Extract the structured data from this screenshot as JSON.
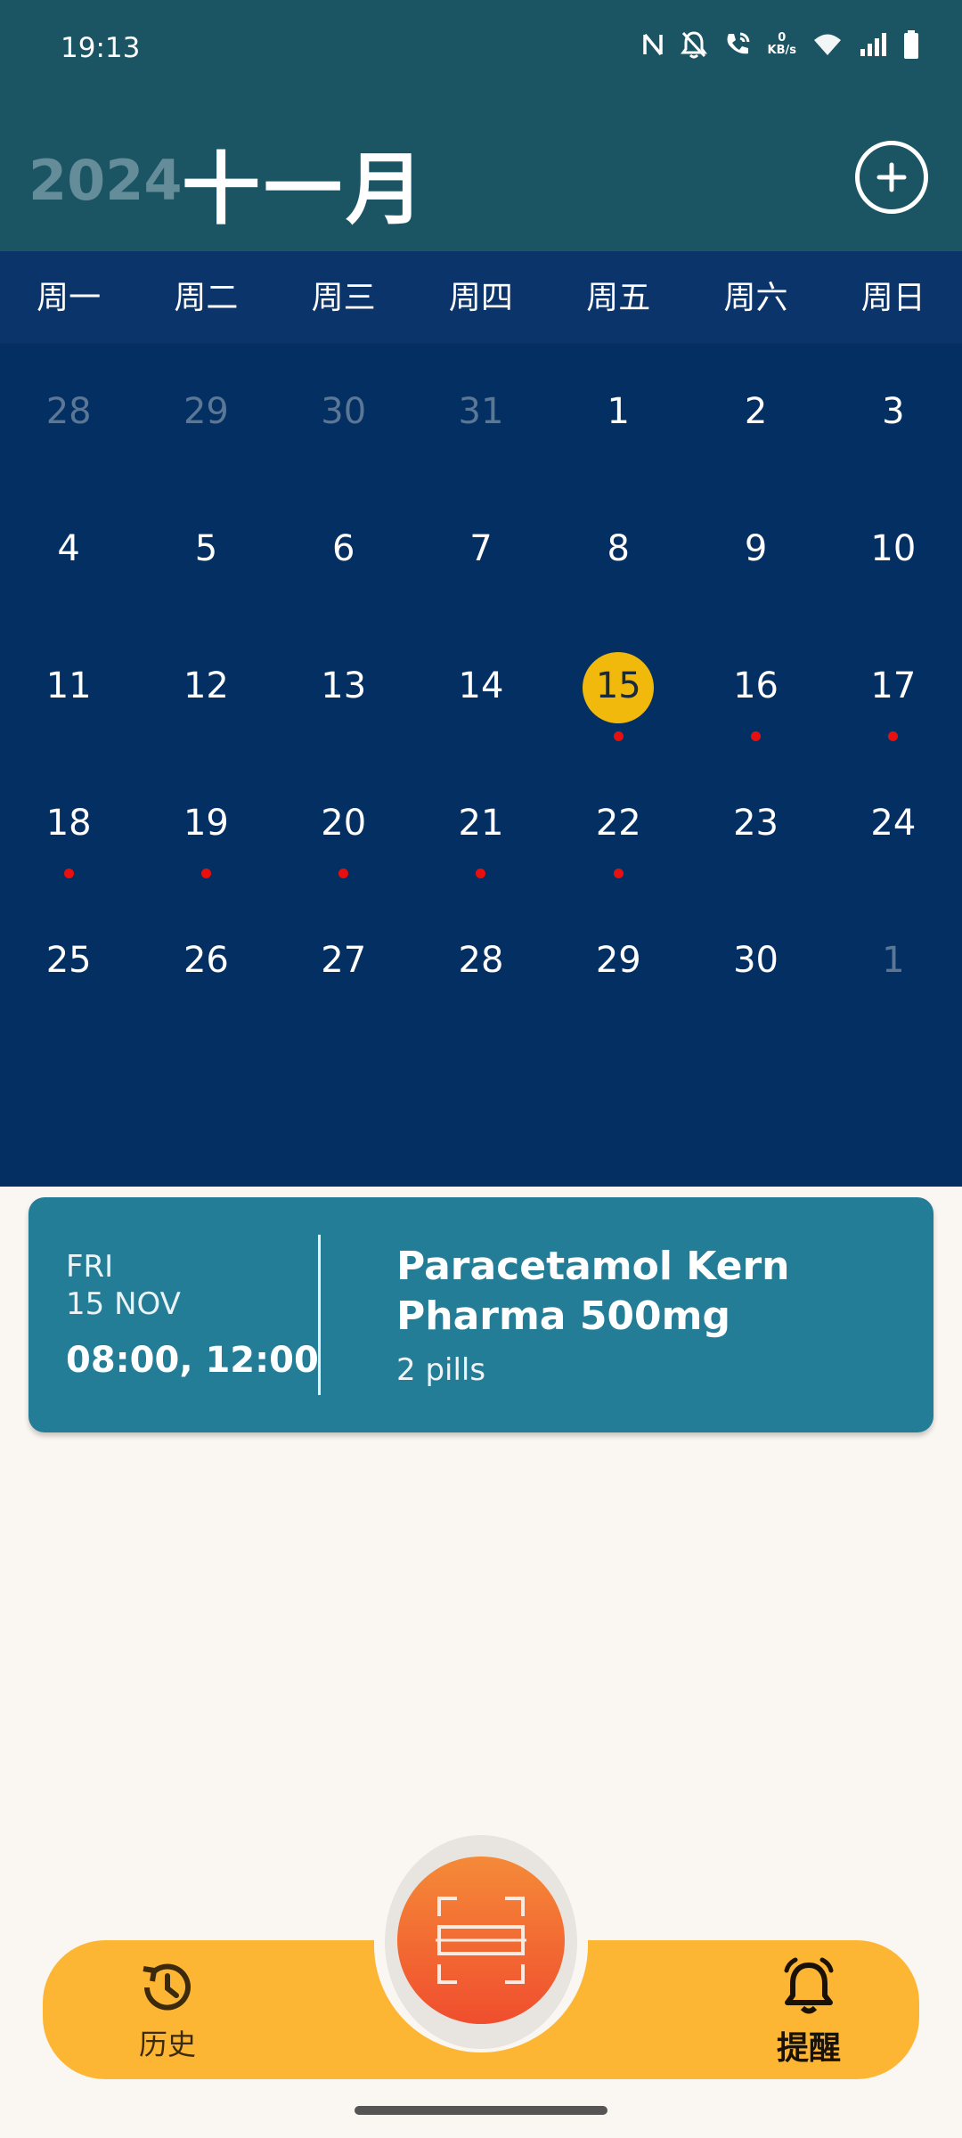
{
  "status": {
    "time": "19:13",
    "net_speed_value": "0",
    "net_speed_unit": "KB/s",
    "icons": [
      "nfc-icon",
      "bell-off-icon",
      "wifi-calling-icon",
      "wifi-icon",
      "signal-icon",
      "battery-icon"
    ]
  },
  "header": {
    "year": "2024",
    "month": "十一月",
    "add_icon": "plus-circle-icon"
  },
  "weekdays": [
    "周一",
    "周二",
    "周三",
    "周四",
    "周五",
    "周六",
    "周日"
  ],
  "calendar": {
    "days": [
      {
        "label": "28",
        "muted": true,
        "dot": false,
        "today": false
      },
      {
        "label": "29",
        "muted": true,
        "dot": false,
        "today": false
      },
      {
        "label": "30",
        "muted": true,
        "dot": false,
        "today": false
      },
      {
        "label": "31",
        "muted": true,
        "dot": false,
        "today": false
      },
      {
        "label": "1",
        "muted": false,
        "dot": false,
        "today": false
      },
      {
        "label": "2",
        "muted": false,
        "dot": false,
        "today": false
      },
      {
        "label": "3",
        "muted": false,
        "dot": false,
        "today": false
      },
      {
        "label": "4",
        "muted": false,
        "dot": false,
        "today": false
      },
      {
        "label": "5",
        "muted": false,
        "dot": false,
        "today": false
      },
      {
        "label": "6",
        "muted": false,
        "dot": false,
        "today": false
      },
      {
        "label": "7",
        "muted": false,
        "dot": false,
        "today": false
      },
      {
        "label": "8",
        "muted": false,
        "dot": false,
        "today": false
      },
      {
        "label": "9",
        "muted": false,
        "dot": false,
        "today": false
      },
      {
        "label": "10",
        "muted": false,
        "dot": false,
        "today": false
      },
      {
        "label": "11",
        "muted": false,
        "dot": false,
        "today": false
      },
      {
        "label": "12",
        "muted": false,
        "dot": false,
        "today": false
      },
      {
        "label": "13",
        "muted": false,
        "dot": false,
        "today": false
      },
      {
        "label": "14",
        "muted": false,
        "dot": false,
        "today": false
      },
      {
        "label": "15",
        "muted": false,
        "dot": true,
        "today": true
      },
      {
        "label": "16",
        "muted": false,
        "dot": true,
        "today": false
      },
      {
        "label": "17",
        "muted": false,
        "dot": true,
        "today": false
      },
      {
        "label": "18",
        "muted": false,
        "dot": true,
        "today": false
      },
      {
        "label": "19",
        "muted": false,
        "dot": true,
        "today": false
      },
      {
        "label": "20",
        "muted": false,
        "dot": true,
        "today": false
      },
      {
        "label": "21",
        "muted": false,
        "dot": true,
        "today": false
      },
      {
        "label": "22",
        "muted": false,
        "dot": true,
        "today": false
      },
      {
        "label": "23",
        "muted": false,
        "dot": false,
        "today": false
      },
      {
        "label": "24",
        "muted": false,
        "dot": false,
        "today": false
      },
      {
        "label": "25",
        "muted": false,
        "dot": false,
        "today": false
      },
      {
        "label": "26",
        "muted": false,
        "dot": false,
        "today": false
      },
      {
        "label": "27",
        "muted": false,
        "dot": false,
        "today": false
      },
      {
        "label": "28",
        "muted": false,
        "dot": false,
        "today": false
      },
      {
        "label": "29",
        "muted": false,
        "dot": false,
        "today": false
      },
      {
        "label": "30",
        "muted": false,
        "dot": false,
        "today": false
      },
      {
        "label": "1",
        "muted": true,
        "dot": false,
        "today": false
      }
    ]
  },
  "colors": {
    "header_bg": "#1b5463",
    "calendar_bg": "#042f62",
    "today_highlight": "#f0b90b",
    "reminder_dot": "#e8100f",
    "card_bg": "#247d96",
    "nav_bg": "#fdb534",
    "fab": "#f2603a"
  },
  "reminder_card": {
    "weekday": "FRI",
    "date": "15 NOV",
    "times": "08:00, 12:00",
    "medication": "Paracetamol Kern Pharma 500mg",
    "dose": "2 pills"
  },
  "bottom_nav": {
    "history_label": "历史",
    "history_icon": "history-icon",
    "scan_icon": "scan-icon",
    "reminders_label": "提醒",
    "reminders_icon": "bell-icon"
  }
}
